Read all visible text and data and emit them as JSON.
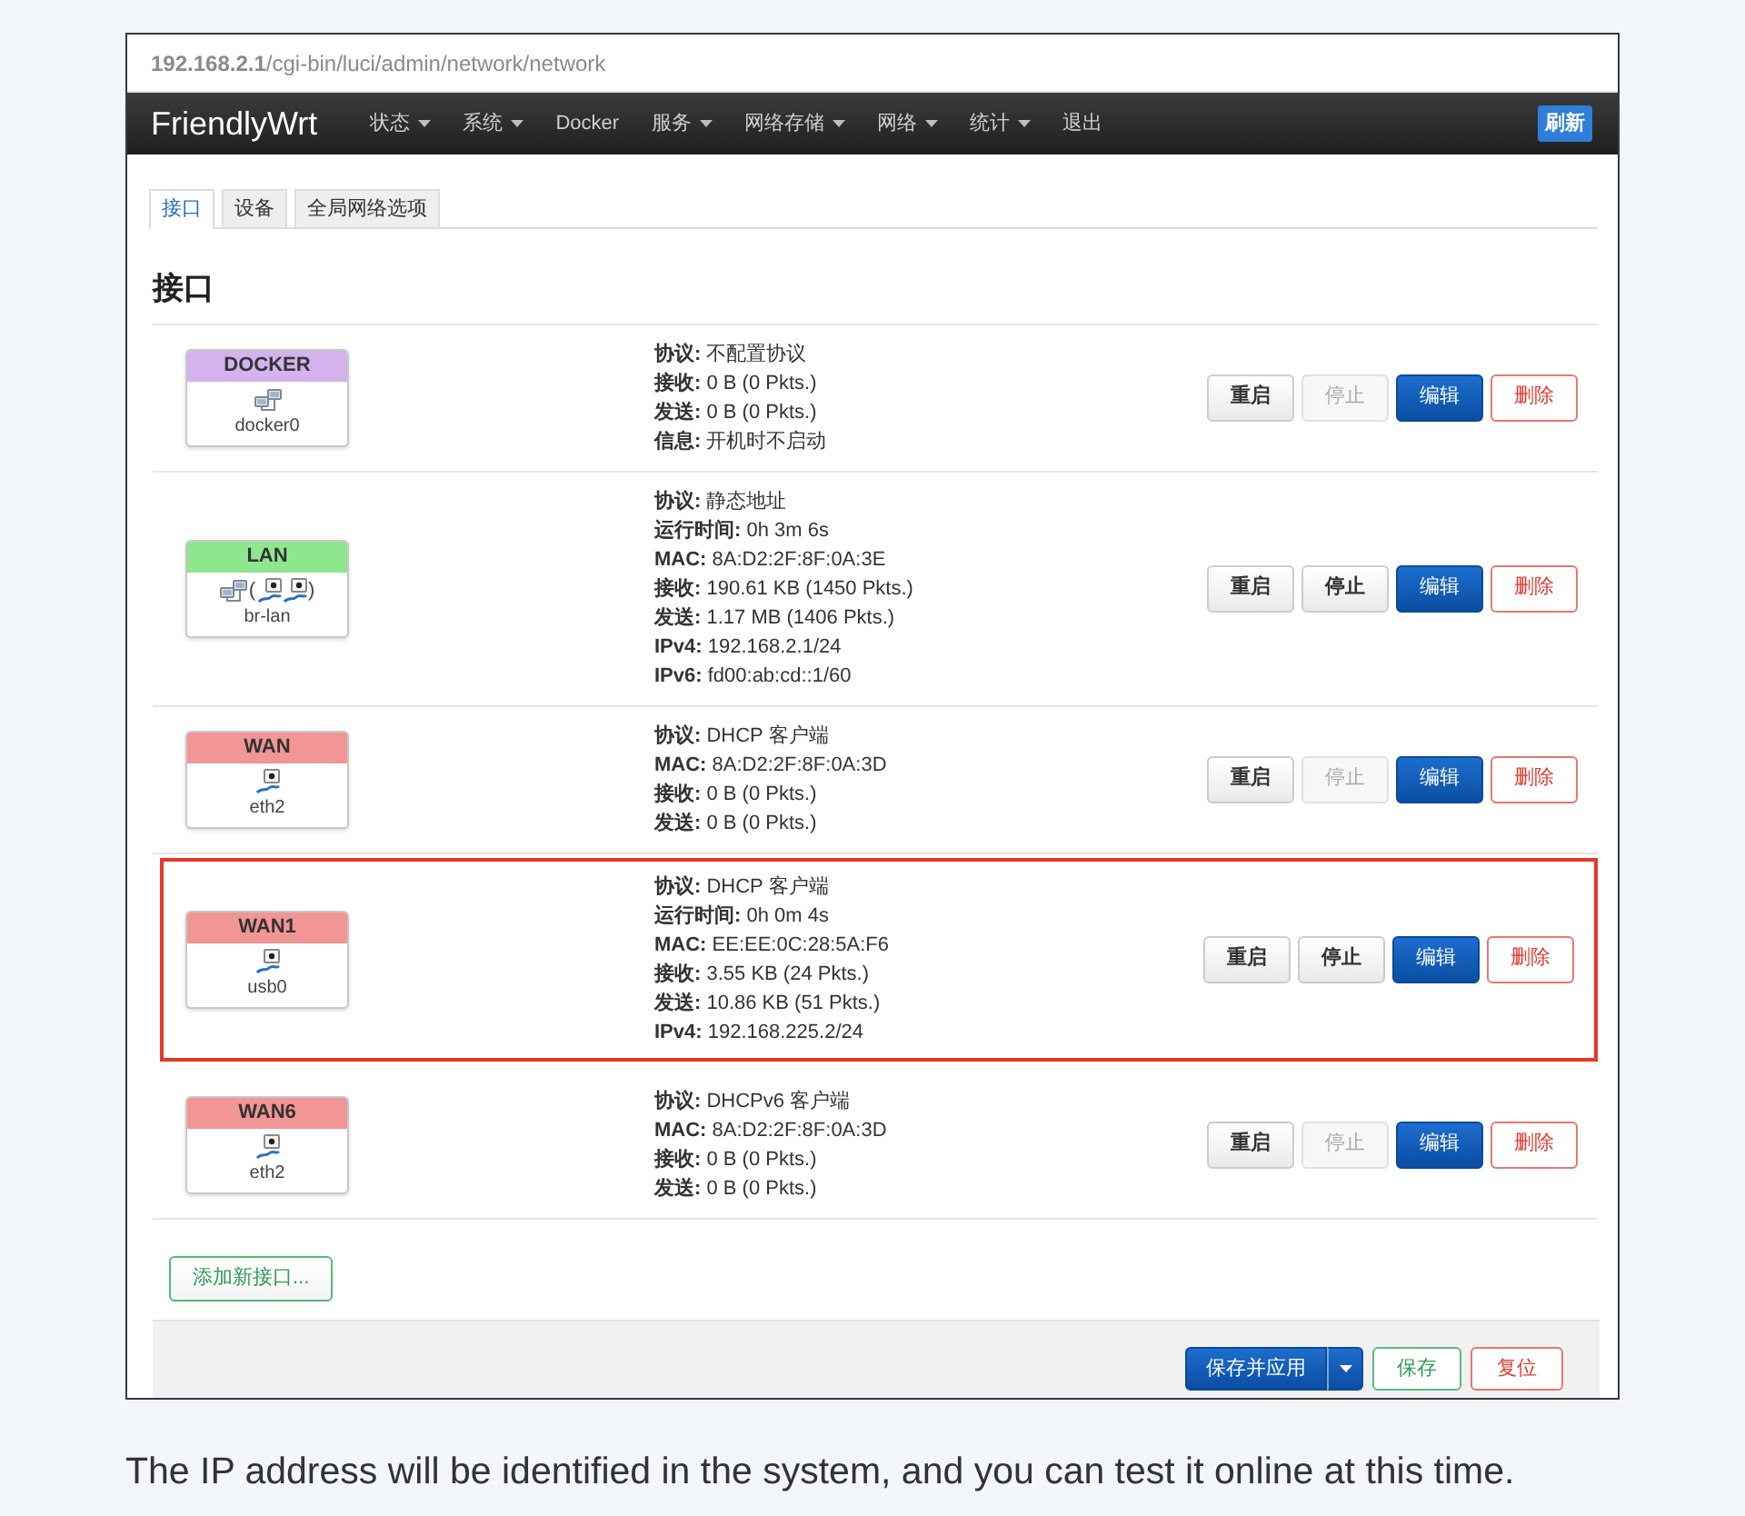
{
  "address_bar": {
    "url": "**192.168.2.1**/cgi-bin/luci/admin/network/network"
  },
  "navbar": {
    "brand": "FriendlyWrt",
    "menu": [
      {
        "label": "状态",
        "dropdown": true
      },
      {
        "label": "系统",
        "dropdown": true
      },
      {
        "label": "Docker",
        "dropdown": false
      },
      {
        "label": "服务",
        "dropdown": true
      },
      {
        "label": "网络存储",
        "dropdown": true
      },
      {
        "label": "网络",
        "dropdown": true
      },
      {
        "label": "统计",
        "dropdown": true
      },
      {
        "label": "退出",
        "dropdown": false
      }
    ],
    "refresh": "刷新"
  },
  "tabs": [
    {
      "label": "接口",
      "selected": true
    },
    {
      "label": "设备",
      "selected": false
    },
    {
      "label": "全局网络选项",
      "selected": false
    }
  ],
  "section_title": "接口",
  "interfaces": [
    {
      "name": "DOCKER",
      "color": "#d4b2ee",
      "highlighted": false,
      "device_icons": [
        {
          "kind": "bridge"
        }
      ],
      "device": "docker0",
      "info": [
        "**协议:** 不配置协议",
        "**接收:** 0 B (0 Pkts.)",
        "**发送:** 0 B (0 Pkts.)",
        "**信息:** 开机时不启动"
      ],
      "buttons": [
        {
          "label": "重启",
          "kind": "default",
          "disabled": false
        },
        {
          "label": "停止",
          "kind": "default",
          "disabled": true
        },
        {
          "label": "编辑",
          "kind": "primary",
          "disabled": false
        },
        {
          "label": "删除",
          "kind": "danger",
          "disabled": false
        }
      ]
    },
    {
      "name": "LAN",
      "color": "#8ee78e",
      "highlighted": false,
      "device_icons": [
        {
          "kind": "bridge"
        },
        {
          "kind": "text",
          "text": "("
        },
        {
          "kind": "port"
        },
        {
          "kind": "port"
        },
        {
          "kind": "text",
          "text": ")"
        }
      ],
      "device": "br-lan",
      "info": [
        "**协议:** 静态地址",
        "**运行时间:** 0h 3m 6s",
        "**MAC:** 8A:D2:2F:8F:0A:3E",
        "**接收:** 190.61 KB (1450 Pkts.)",
        "**发送:** 1.17 MB (1406 Pkts.)",
        "**IPv4:** 192.168.2.1/24",
        "**IPv6:** fd00:ab:cd::1/60"
      ],
      "buttons": [
        {
          "label": "重启",
          "kind": "default",
          "disabled": false
        },
        {
          "label": "停止",
          "kind": "default",
          "disabled": false
        },
        {
          "label": "编辑",
          "kind": "primary",
          "disabled": false
        },
        {
          "label": "删除",
          "kind": "danger",
          "disabled": false
        }
      ]
    },
    {
      "name": "WAN",
      "color": "#f19595",
      "highlighted": false,
      "device_icons": [
        {
          "kind": "port"
        }
      ],
      "device": "eth2",
      "info": [
        "**协议:** DHCP 客户端",
        "**MAC:** 8A:D2:2F:8F:0A:3D",
        "**接收:** 0 B (0 Pkts.)",
        "**发送:** 0 B (0 Pkts.)"
      ],
      "buttons": [
        {
          "label": "重启",
          "kind": "default",
          "disabled": false
        },
        {
          "label": "停止",
          "kind": "default",
          "disabled": true
        },
        {
          "label": "编辑",
          "kind": "primary",
          "disabled": false
        },
        {
          "label": "删除",
          "kind": "danger",
          "disabled": false
        }
      ]
    },
    {
      "name": "WAN1",
      "color": "#f19595",
      "highlighted": true,
      "device_icons": [
        {
          "kind": "port"
        }
      ],
      "device": "usb0",
      "info": [
        "**协议:** DHCP 客户端",
        "**运行时间:** 0h 0m 4s",
        "**MAC:** EE:EE:0C:28:5A:F6",
        "**接收:** 3.55 KB (24 Pkts.)",
        "**发送:** 10.86 KB (51 Pkts.)",
        "**IPv4:** 192.168.225.2/24"
      ],
      "buttons": [
        {
          "label": "重启",
          "kind": "default",
          "disabled": false
        },
        {
          "label": "停止",
          "kind": "default",
          "disabled": false
        },
        {
          "label": "编辑",
          "kind": "primary",
          "disabled": false
        },
        {
          "label": "删除",
          "kind": "danger",
          "disabled": false
        }
      ]
    },
    {
      "name": "WAN6",
      "color": "#f19595",
      "highlighted": false,
      "device_icons": [
        {
          "kind": "port"
        }
      ],
      "device": "eth2",
      "info": [
        "**协议:** DHCPv6 客户端",
        "**MAC:** 8A:D2:2F:8F:0A:3D",
        "**接收:** 0 B (0 Pkts.)",
        "**发送:** 0 B (0 Pkts.)"
      ],
      "buttons": [
        {
          "label": "重启",
          "kind": "default",
          "disabled": false
        },
        {
          "label": "停止",
          "kind": "default",
          "disabled": true
        },
        {
          "label": "编辑",
          "kind": "primary",
          "disabled": false
        },
        {
          "label": "删除",
          "kind": "danger",
          "disabled": false
        }
      ]
    }
  ],
  "add_button": "添加新接口...",
  "actions": [
    {
      "label": "保存并应用",
      "kind": "primary",
      "split": true
    },
    {
      "label": "保存",
      "kind": "success",
      "split": false
    },
    {
      "label": "复位",
      "kind": "danger",
      "split": false
    }
  ],
  "caption": "The IP address will be identified in the system, and you can test it online at this time."
}
